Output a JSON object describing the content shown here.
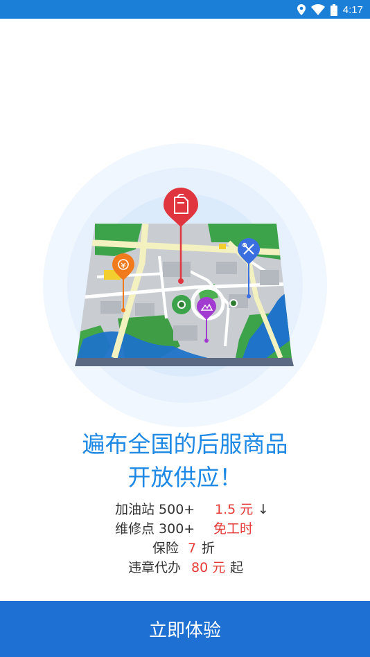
{
  "status_bar": {
    "time": "4:17",
    "icons": [
      "location-icon",
      "wifi-icon",
      "battery-icon"
    ]
  },
  "hero": {
    "pins": [
      "gas-can-icon",
      "tools-icon",
      "discount-icon",
      "insurance-icon"
    ],
    "colors": {
      "halo": "#e8f2fd",
      "road": "#f4f1c0",
      "park": "#3da34a",
      "water": "#1f73c8",
      "gas_pin": "#e0353f",
      "tools_pin": "#3a6fe0",
      "discount_pin": "#f07a1c",
      "insurance_pin": "#a23bcf"
    }
  },
  "headline": {
    "line1": "遍布全国的后服商品",
    "line2": "开放供应！"
  },
  "features": {
    "gas": {
      "label": "加油站 500+",
      "value": "1.5 元",
      "arrow": "↓"
    },
    "repair": {
      "label": "维修点 300+",
      "value": "免工时"
    },
    "insurance": {
      "label": "保险",
      "value": "7",
      "suffix": "折"
    },
    "violation": {
      "label": "违章代办",
      "value": "80 元",
      "suffix": "起"
    }
  },
  "cta": {
    "label": "立即体验"
  },
  "colors": {
    "brand_blue": "#1f70d3",
    "headline_blue": "#1e88e5",
    "highlight_red": "#e53935"
  }
}
